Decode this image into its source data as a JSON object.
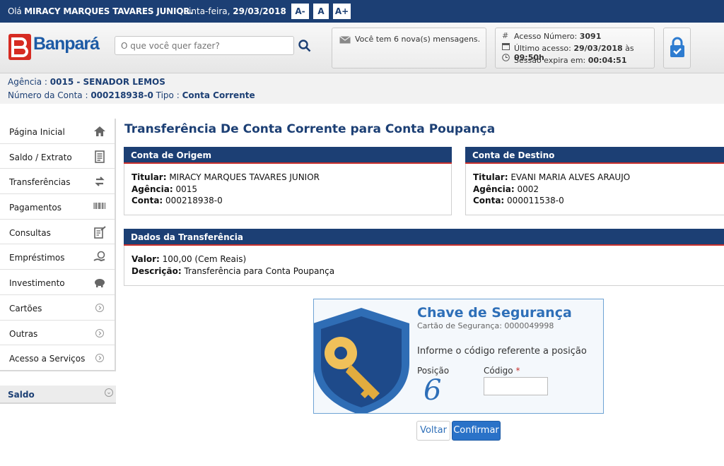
{
  "topbar": {
    "greeting_prefix": "Olá ",
    "user_name": "MIRACY MARQUES TAVARES JUNIOR.",
    "weekday": "Quinta-feira, ",
    "date": "29/03/2018",
    "font_decrease": "A-",
    "font_normal": "A",
    "font_increase": "A+"
  },
  "header": {
    "logo_text": "Banpará",
    "search_placeholder": "O que você quer fazer?",
    "messages": "Você tem 6 nova(s) mensagens.",
    "access_number_label": "Acesso Número: ",
    "access_number": "3091",
    "last_access_label": "Último acesso: ",
    "last_access_date": "29/03/2018",
    "last_access_at": " às ",
    "last_access_time": "09:50h",
    "session_label": "Sessão expira em: ",
    "session_time": "00:04:51"
  },
  "account": {
    "agency_label": "Agência : ",
    "agency": "0015 - SENADOR LEMOS",
    "number_label": "Número da Conta : ",
    "number": "000218938-0",
    "type_label": " Tipo : ",
    "type": "Conta Corrente"
  },
  "sidebar": {
    "items": [
      {
        "label": "Página Inicial",
        "icon": "home-icon"
      },
      {
        "label": "Saldo / Extrato",
        "icon": "statement-icon"
      },
      {
        "label": "Transferências",
        "icon": "transfer-icon"
      },
      {
        "label": "Pagamentos",
        "icon": "barcode-icon"
      },
      {
        "label": "Consultas",
        "icon": "document-check-icon"
      },
      {
        "label": "Empréstimos",
        "icon": "loan-icon"
      },
      {
        "label": "Investimento",
        "icon": "piggy-bank-icon"
      },
      {
        "label": "Cartões",
        "icon": "chevron-right-icon"
      },
      {
        "label": "Outras",
        "icon": "chevron-right-icon"
      },
      {
        "label": "Acesso a Serviços",
        "icon": "chevron-right-icon"
      }
    ],
    "balance_label": "Saldo"
  },
  "main": {
    "title": "Transferência De Conta Corrente para Conta Poupança",
    "origin": {
      "heading": "Conta de Origem",
      "holder_label": "Titular:",
      "holder": " MIRACY MARQUES TAVARES JUNIOR",
      "agency_label": "Agência:",
      "agency": " 0015",
      "account_label": "Conta:",
      "account": " 000218938-0"
    },
    "destination": {
      "heading": "Conta de Destino",
      "holder_label": "Titular:",
      "holder": " EVANI MARIA ALVES ARAUJO",
      "agency_label": "Agência:",
      "agency": " 0002",
      "account_label": "Conta:",
      "account": " 000011538-0"
    },
    "transfer": {
      "heading": "Dados da Transferência",
      "value_label": "Valor:",
      "value": " 100,00 (Cem Reais)",
      "description_label": "Descrição:",
      "description": " Transferência para Conta Poupança"
    }
  },
  "security": {
    "title": "Chave de Segurança",
    "card_label": "Cartão de Segurança: ",
    "card_number": "0000049998",
    "instruction": "Informe o código referente a posição",
    "position_label": "Posição",
    "position_value": "6",
    "code_label": "Código ",
    "code_required": "*",
    "code_value": ""
  },
  "buttons": {
    "back": "Voltar",
    "confirm": "Confirmar"
  },
  "colors": {
    "brand_navy": "#1c3f74",
    "brand_red": "#d62b22",
    "accent_blue": "#2e6fb8"
  }
}
